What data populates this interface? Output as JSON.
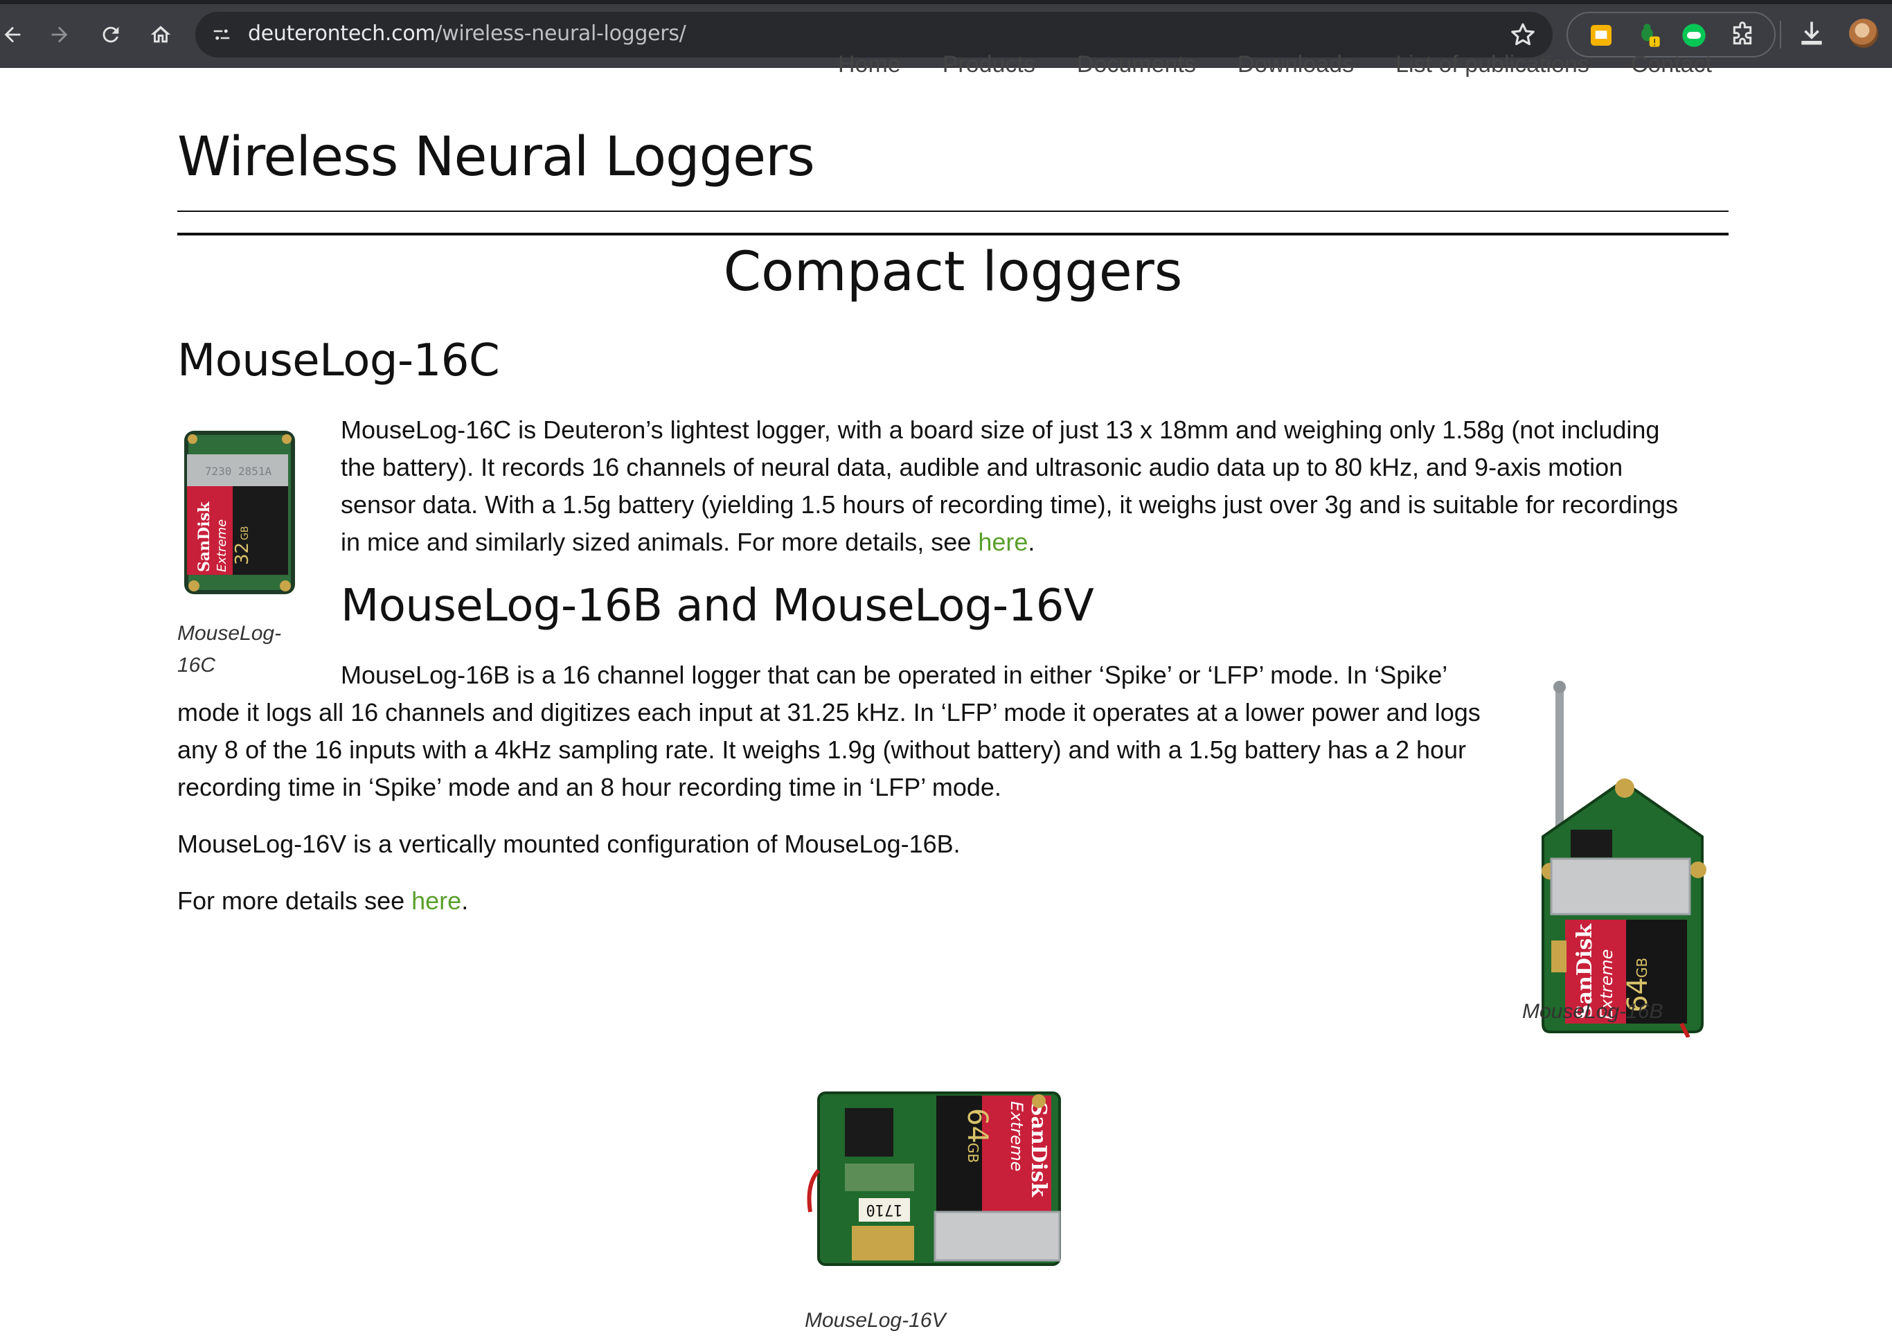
{
  "browser": {
    "url_domain": "deuterontech.com",
    "url_path": "/wireless-neural-loggers/"
  },
  "site_nav": {
    "items": [
      "Home",
      "Products",
      "Documents",
      "Downloads",
      "List of publications",
      "Contact"
    ]
  },
  "page": {
    "title": "Wireless Neural Loggers",
    "section_title": "Compact loggers",
    "mouselog_16c": {
      "heading": "MouseLog-16C",
      "body": "MouseLog-16C is Deuteron’s lightest logger, with a board size of just 13 x 18mm and weighing only 1.58g (not including the battery). It records 16 channels of neural data, audible and ultrasonic audio data up to 80 kHz, and 9-axis motion sensor data. With a 1.5g battery (yielding 1.5 hours of recording time), it weighs just over 3g and is suitable for recordings in mice and similarly sized animals. For more details, see ",
      "link": "here",
      "tail": ".",
      "caption": "MouseLog-16C"
    },
    "mouselog_16bv": {
      "heading": "MouseLog-16B and MouseLog-16V",
      "body_b": "MouseLog-16B is a 16 channel logger that can be operated in either ‘Spike’ or ‘LFP’ mode. In ‘Spike’ mode it logs all 16 channels and digitizes each input at 31.25 kHz. In ‘LFP’ mode it operates at a lower power and logs any 8 of the 16 inputs with a 4kHz sampling rate. It weighs 1.9g (without battery) and with a 1.5g battery has a 2 hour recording time in ‘Spike’ mode and an 8 hour recording time in ‘LFP’ mode.",
      "body_v": "MouseLog-16V is a vertically mounted configuration of MouseLog-16B.",
      "more_prefix": "For more details see ",
      "link": "here",
      "tail": ".",
      "caption_b": "MouseLog-16B",
      "caption_v": "MouseLog-16V"
    },
    "sd_card": {
      "brand": "SanDisk",
      "line": "Extreme",
      "cap_32": "32",
      "cap_64": "64",
      "unit": "GB"
    }
  },
  "colors": {
    "link": "#5aa02c",
    "chrome_bg": "#3c3d42",
    "omnibox_bg": "#28292d"
  }
}
